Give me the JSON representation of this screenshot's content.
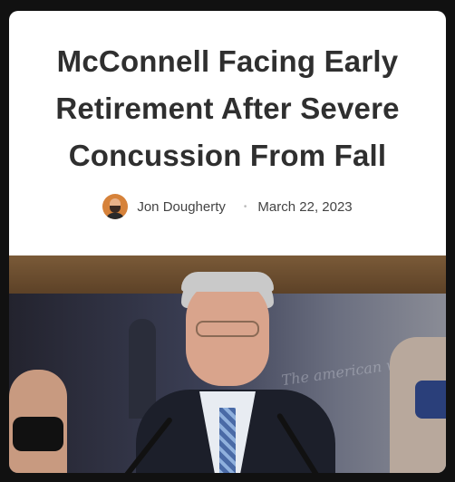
{
  "article": {
    "title_lines": [
      "McConnell Facing Early",
      "Retirement After Severe",
      "Concussion From Fall"
    ],
    "author": "Jon Dougherty",
    "date": "March 22, 2023",
    "separator": "•",
    "photo_watermark": "The american way"
  }
}
